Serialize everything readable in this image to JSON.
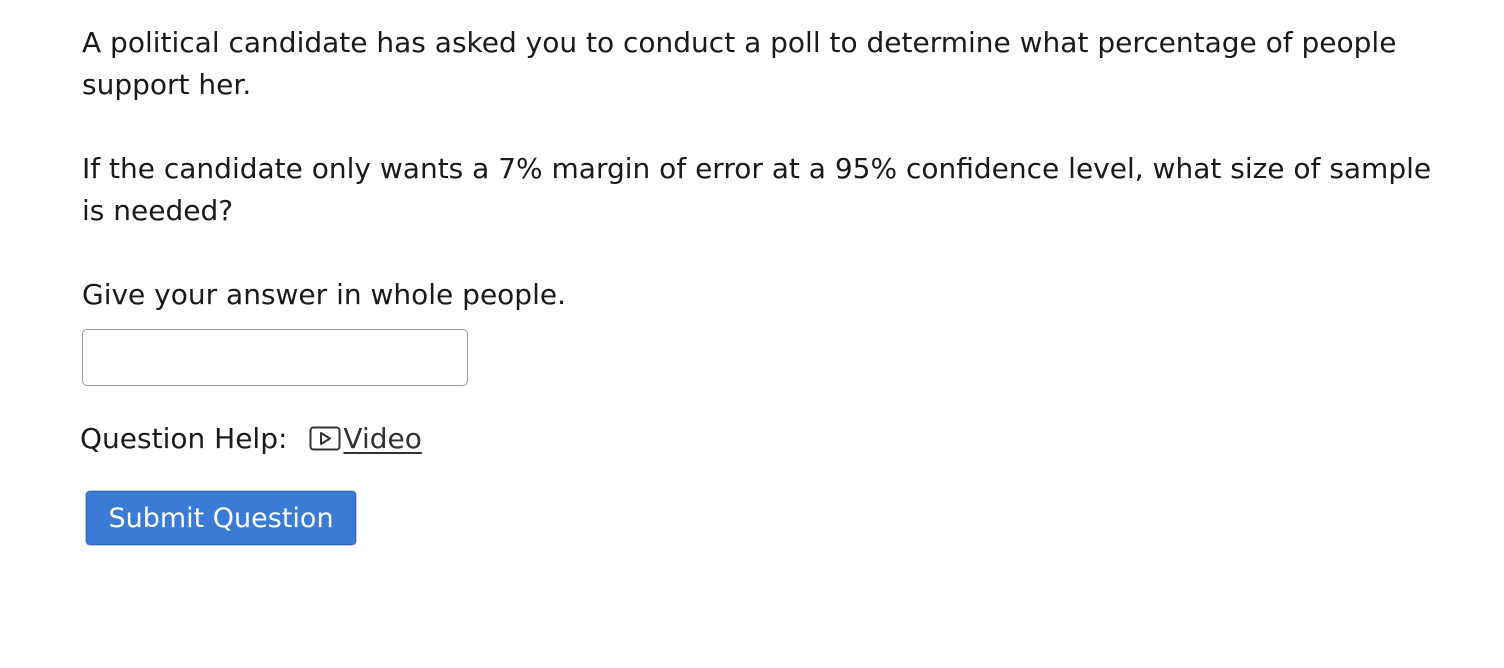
{
  "question": {
    "paragraphs": [
      "A political candidate has asked you to conduct a poll to determine what percentage of people support her.",
      "If the candidate only wants a 7% margin of error at a 95% confidence level, what size of sample is needed?",
      "Give your answer in whole people."
    ]
  },
  "answer": {
    "value": "",
    "placeholder": ""
  },
  "help": {
    "label": "Question Help:",
    "video_label": "Video",
    "video_icon": "play-video-icon"
  },
  "submit": {
    "label": "Submit Question",
    "color": "#3a7bd5"
  }
}
